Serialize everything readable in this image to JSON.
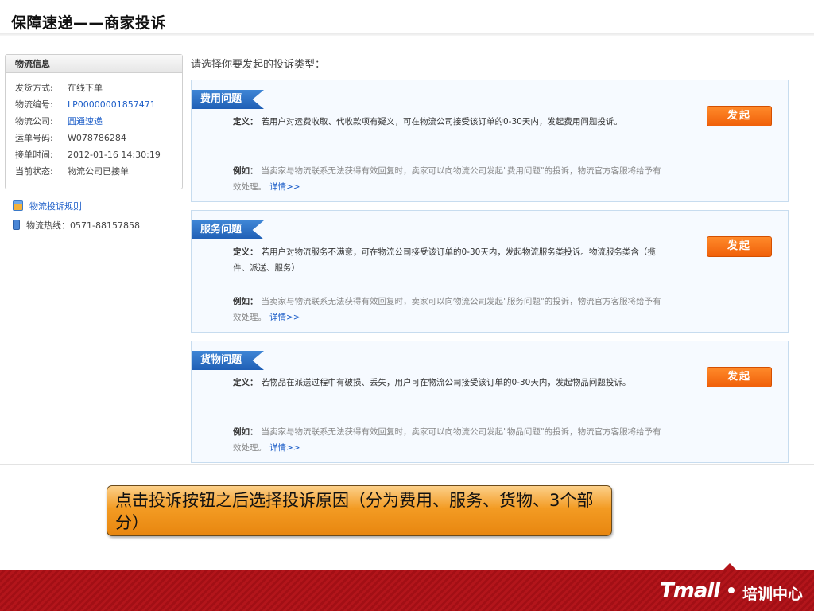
{
  "slide": {
    "title": "保障速递——商家投诉"
  },
  "info_panel": {
    "title": "物流信息",
    "rows": [
      {
        "label": "发货方式:",
        "value": "在线下单"
      },
      {
        "label": "物流编号:",
        "value": "LP00000001857471"
      },
      {
        "label": "物流公司:",
        "value": "圆通速递"
      },
      {
        "label": "运单号码:",
        "value": "W078786284"
      },
      {
        "label": "接单时间:",
        "value": "2012-01-16 14:30:19"
      },
      {
        "label": "当前状态:",
        "value": "物流公司已接单"
      }
    ]
  },
  "side_links": {
    "rules": "物流投诉规则",
    "hotline": "物流热线：0571-88157858"
  },
  "prompt": "请选择你要发起的投诉类型：",
  "cards": [
    {
      "tag": "费用问题",
      "def_label": "定义：",
      "def_text": "若用户对运费收取、代收款项有疑义，可在物流公司接受该订单的0-30天内，发起费用问题投诉。",
      "ex_label": "例如：",
      "ex_text": "当卖家与物流联系无法获得有效回复时，卖家可以向物流公司发起\"费用问题\"的投诉，物流官方客服将给予有效处理。",
      "more": "详情>>",
      "button": "发起"
    },
    {
      "tag": "服务问题",
      "def_label": "定义：",
      "def_text": "若用户对物流服务不满意，可在物流公司接受该订单的0-30天内，发起物流服务类投诉。物流服务类含（揽件、派送、服务）",
      "ex_label": "例如：",
      "ex_text": "当卖家与物流联系无法获得有效回复时，卖家可以向物流公司发起\"服务问题\"的投诉，物流官方客服将给予有效处理。",
      "more": "详情>>",
      "button": "发起"
    },
    {
      "tag": "货物问题",
      "def_label": "定义：",
      "def_text": "若物品在派送过程中有破损、丢失，用户可在物流公司接受该订单的0-30天内，发起物品问题投诉。",
      "ex_label": "例如：",
      "ex_text": "当卖家与物流联系无法获得有效回复时，卖家可以向物流公司发起\"物品问题\"的投诉，物流官方客服将给予有效处理。",
      "more": "详情>>",
      "button": "发起"
    }
  ],
  "callout": "点击投诉按钮之后选择投诉原因（分为费用、服务、货物、3个部分）",
  "footer": {
    "brand": "Tmall",
    "text": "培训中心"
  },
  "colors": {
    "accent_blue": "#1f5fb5",
    "button_orange": "#f0600a",
    "footer_red": "#b3151b",
    "callout_orange": "#f39b23"
  }
}
